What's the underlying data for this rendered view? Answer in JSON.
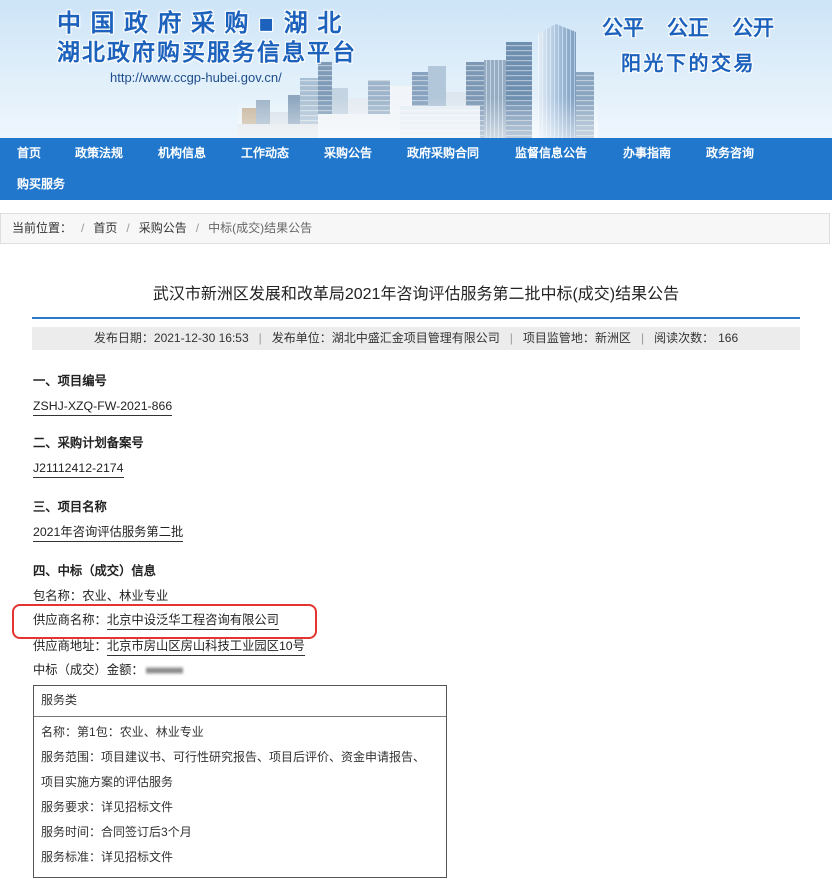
{
  "header": {
    "title_line1": "中国政府采购▪湖北",
    "title_line2": "湖北政府购买服务信息平台",
    "url": "http://www.ccgp-hubei.gov.cn/",
    "slogans": [
      "公平",
      "公正",
      "公开"
    ],
    "tagline": "阳光下的交易"
  },
  "nav": {
    "items": [
      "首页",
      "政策法规",
      "机构信息",
      "工作动态",
      "采购公告",
      "政府采购合同",
      "监督信息公告",
      "办事指南",
      "政务咨询",
      "购买服务"
    ]
  },
  "breadcrumb": {
    "label": "当前位置：",
    "separator": "/",
    "items": [
      "首页",
      "采购公告",
      "中标(成交)结果公告"
    ]
  },
  "article": {
    "title": "武汉市新洲区发展和改革局2021年咨询评估服务第二批中标(成交)结果公告",
    "meta": {
      "publish_date_label": "发布日期：",
      "publish_date": "2021-12-30 16:53",
      "publisher_label": "发布单位：",
      "publisher": "湖北中盛汇金项目管理有限公司",
      "region_label": "项目监管地：",
      "region": "新洲区",
      "views_label": "阅读次数：",
      "views": "166",
      "separator": "|"
    },
    "project_number": {
      "heading": "一、项目编号",
      "value": "ZSHJ-XZQ-FW-2021-866"
    },
    "plan_number": {
      "heading": "二、采购计划备案号",
      "value": "J21112412-2174"
    },
    "project_name": {
      "heading": "三、项目名称",
      "value": "2021年咨询评估服务第二批"
    },
    "award": {
      "heading": "四、中标（成交）信息",
      "package_label": "包名称：",
      "package": "农业、林业专业",
      "supplier_label": "供应商名称：",
      "supplier": "北京中设泛华工程咨询有限公司",
      "address_label": "供应商地址：",
      "address": "北京市房山区房山科技工业园区10号",
      "amount_label": "中标（成交）金额："
    },
    "service_table": {
      "header": "服务类",
      "rows": [
        {
          "label": "名称：",
          "value": "第1包：农业、林业专业"
        },
        {
          "label": "服务范围：",
          "value": "项目建议书、可行性研究报告、项目后评价、资金申请报告、项目实施方案的评估服务"
        },
        {
          "label": "服务要求：",
          "value": "详见招标文件"
        },
        {
          "label": "服务时间：",
          "value": "合同签订后3个月"
        },
        {
          "label": "服务标准：",
          "value": "详见招标文件"
        }
      ]
    }
  },
  "colors": {
    "brand_blue": "#1c62bd",
    "nav_background": "#2077cc",
    "title_rule": "#2a79cf",
    "highlight": "#e3342f"
  }
}
